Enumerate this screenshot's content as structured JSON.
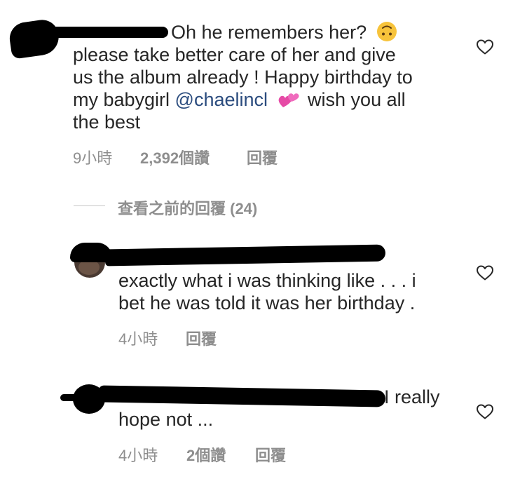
{
  "comments": [
    {
      "text_line1": "Oh he remembers her?",
      "emoji1": "upside-down-face-emoji",
      "text_line2": "please take better care of her and give",
      "text_line3": "us the album already ! Happy birthday to",
      "text_line4_pre": "my babygirl ",
      "mention": "@chaelincl",
      "emoji2": "two-hearts-emoji",
      "text_line4_post": "wish you all",
      "text_line5": "the best",
      "time": "9小時",
      "likes": "2,392個讚",
      "reply": "回覆"
    },
    {
      "view_previous_replies": "查看之前的回覆 (24)"
    },
    {
      "text_line1": "exactly what i was thinking like . . . i",
      "text_line2": "bet he was told it was her birthday .",
      "time": "4小時",
      "reply": "回覆"
    },
    {
      "text_line1": "I really",
      "text_line2": "hope not ...",
      "time": "4小時",
      "likes": "2個讚",
      "reply": "回覆"
    }
  ],
  "colors": {
    "text": "#262626",
    "meta": "#8e8e8e",
    "mention": "#2b4c7e",
    "redaction": "#000000"
  }
}
